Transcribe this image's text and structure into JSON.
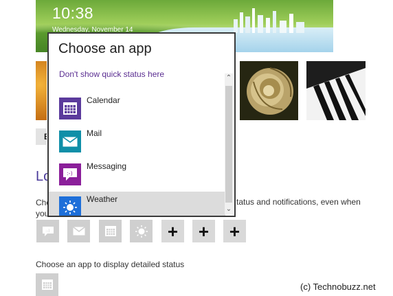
{
  "lockscreen": {
    "time": "10:38",
    "date": "Wednesday, November 14"
  },
  "background": {
    "browse_label": "B"
  },
  "section": {
    "title_fragment": "Lo",
    "description_left": "Cho\nyou",
    "description_right": "tatus and notifications, even when"
  },
  "quick_status": {
    "slots": [
      "messaging-icon",
      "mail-icon",
      "calendar-icon",
      "weather-icon",
      "plus",
      "plus",
      "plus"
    ],
    "plus_symbol": "+"
  },
  "detailed_status": {
    "label": "Choose an app to display detailed status",
    "slot_icon": "calendar-icon"
  },
  "watermark": "(c) Technobuzz.net",
  "flyout": {
    "title": "Choose an app",
    "no_status_link": "Don't show quick status here",
    "apps": [
      {
        "label": "Calendar",
        "color": "#5b3b9c",
        "icon": "calendar-icon",
        "selected": false
      },
      {
        "label": "Mail",
        "color": "#0f8fa8",
        "icon": "mail-icon",
        "selected": false
      },
      {
        "label": "Messaging",
        "color": "#8b1f9a",
        "icon": "messaging-icon",
        "selected": false
      },
      {
        "label": "Weather",
        "color": "#1e6fd9",
        "icon": "weather-icon",
        "selected": true
      }
    ]
  },
  "colors": {
    "accent": "#5a2d91",
    "slot_bg": "#cfcfcf"
  }
}
